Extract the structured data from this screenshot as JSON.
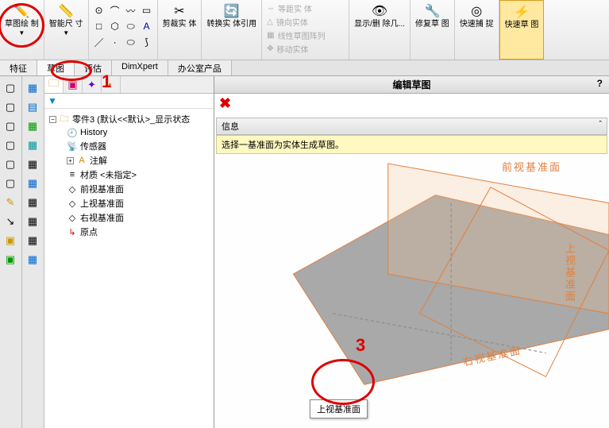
{
  "ribbon": {
    "sketch_draw": "草图绘\n制",
    "smart_dim": "智能尺\n寸",
    "trim": "剪裁实\n体",
    "convert": "转换实\n体引用",
    "mirror": "镜向实体",
    "linear_pattern": "线性草图阵列",
    "move": "移动实体",
    "offset": "等距实\n体",
    "show_hide": "显示/删\n除几...",
    "repair": "修复草\n图",
    "quick_snap": "快速捕\n捉",
    "quick_sketch": "快速草\n图"
  },
  "tabs": {
    "features": "特征",
    "sketch": "草图",
    "evaluate": "评估",
    "dimxpert": "DimXpert",
    "office": "办公室产品"
  },
  "header": {
    "title": "编辑草图",
    "help": "?"
  },
  "info": {
    "section_label": "信息",
    "collapse": "ˆ",
    "message": "选择一基准面为实体生成草图。"
  },
  "tree": {
    "root": "零件3  (默认<<默认>_显示状态",
    "history": "History",
    "sensors": "传感器",
    "annotations": "注解",
    "material": "材质 <未指定>",
    "front_plane": "前视基准面",
    "top_plane": "上视基准面",
    "right_plane": "右视基准面",
    "origin": "原点"
  },
  "viewport": {
    "front_label": "前视基准面",
    "top_label": "上视基准面",
    "right_label": "右视基准面",
    "tooltip": "上视基准面"
  },
  "annotations": {
    "num1": "1",
    "num3": "3"
  }
}
